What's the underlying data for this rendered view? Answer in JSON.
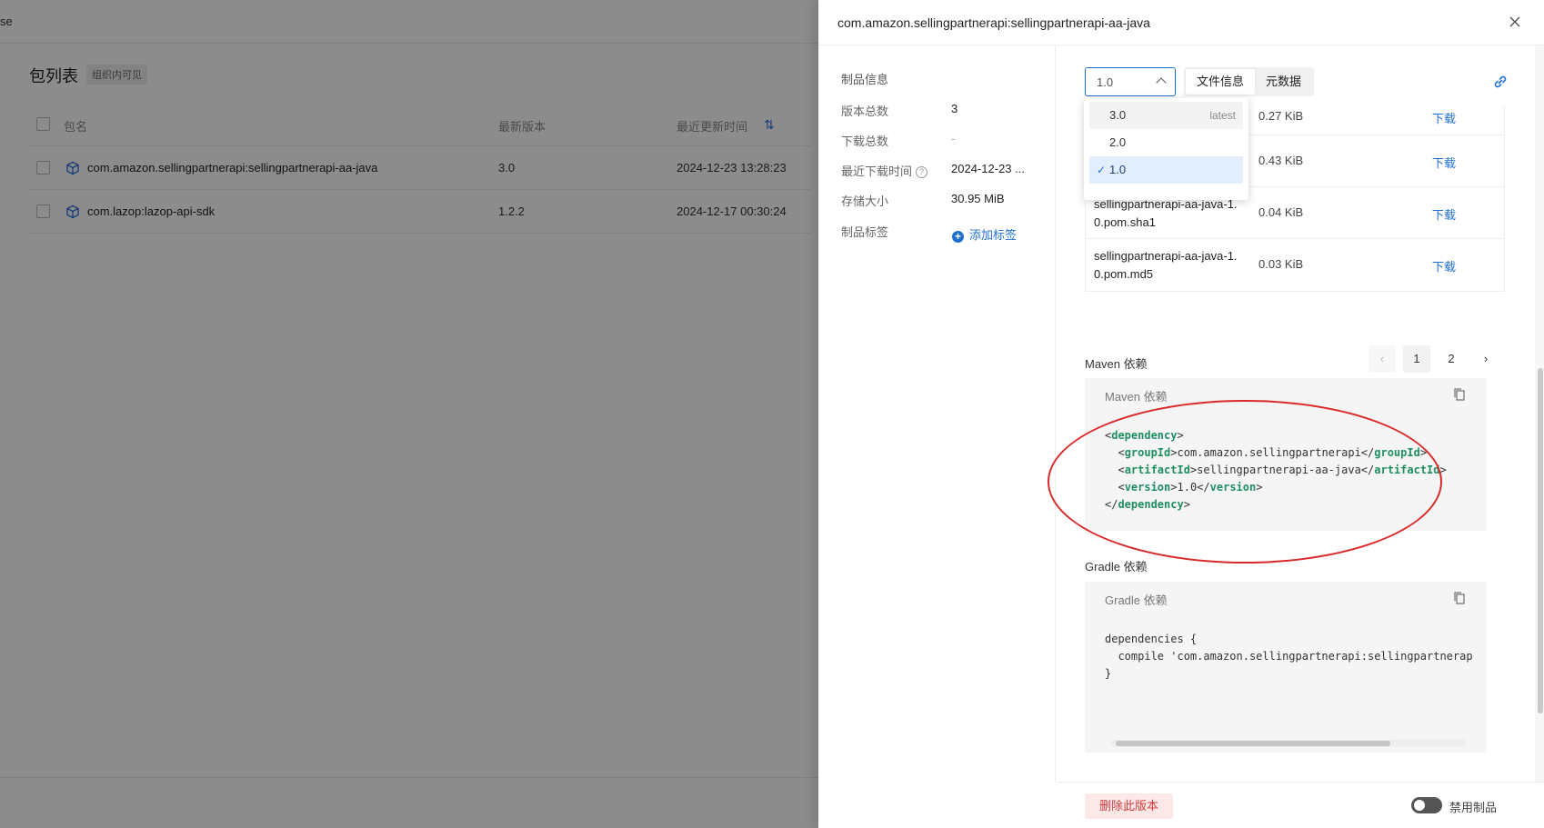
{
  "background": {
    "header_text": "se",
    "title": "包列表",
    "badge": "组织内可见",
    "columns": {
      "name": "包名",
      "version": "最新版本",
      "updated": "最近更新时间"
    },
    "rows": [
      {
        "name": "com.amazon.sellingpartnerapi:sellingpartnerapi-aa-java",
        "version": "3.0",
        "updated": "2024-12-23 13:28:23"
      },
      {
        "name": "com.lazop:lazop-api-sdk",
        "version": "1.2.2",
        "updated": "2024-12-17 00:30:24"
      }
    ]
  },
  "drawer": {
    "title": "com.amazon.sellingpartnerapi:sellingpartnerapi-aa-java",
    "info": {
      "heading": "制品信息",
      "version_count_label": "版本总数",
      "version_count": "3",
      "download_count_label": "下载总数",
      "download_count": "-",
      "last_download_label": "最近下载时间",
      "last_download": "2024-12-23 ...",
      "storage_label": "存储大小",
      "storage": "30.95 MiB",
      "tags_label": "制品标签",
      "add_tag": "添加标签"
    },
    "version_select": {
      "value": "1.0"
    },
    "tabs": [
      "文件信息",
      "元数据"
    ],
    "dropdown": [
      {
        "label": "3.0",
        "tag": "latest"
      },
      {
        "label": "2.0",
        "tag": ""
      },
      {
        "label": "1.0",
        "tag": ""
      }
    ],
    "files": [
      {
        "name": "",
        "size": "0.27 KiB",
        "action": "下载"
      },
      {
        "name": "",
        "size": "0.43 KiB",
        "action": "下载"
      },
      {
        "name": "sellingpartnerapi-aa-java-1.0.pom.sha1",
        "size": "0.04 KiB",
        "action": "下载"
      },
      {
        "name": "sellingpartnerapi-aa-java-1.0.pom.md5",
        "size": "0.03 KiB",
        "action": "下载"
      }
    ],
    "pagination": {
      "pages": [
        "1",
        "2"
      ],
      "current": "1"
    },
    "maven": {
      "section_title": "Maven 依赖",
      "box_title": "Maven 依赖",
      "group_id": "com.amazon.sellingpartnerapi",
      "artifact_id": "sellingpartnerapi-aa-java",
      "version": "1.0"
    },
    "gradle": {
      "section_title": "Gradle 依赖",
      "box_title": "Gradle 依赖",
      "line1": "dependencies {",
      "line2": "  compile 'com.amazon.sellingpartnerapi:sellingpartnerap",
      "line3": "}"
    },
    "footer": {
      "delete_label": "删除此版本",
      "disable_label": "禁用制品"
    }
  },
  "colors": {
    "accent": "#1f6fd1",
    "annotation": "#d82a2a",
    "code_tag": "#1f8f62"
  }
}
